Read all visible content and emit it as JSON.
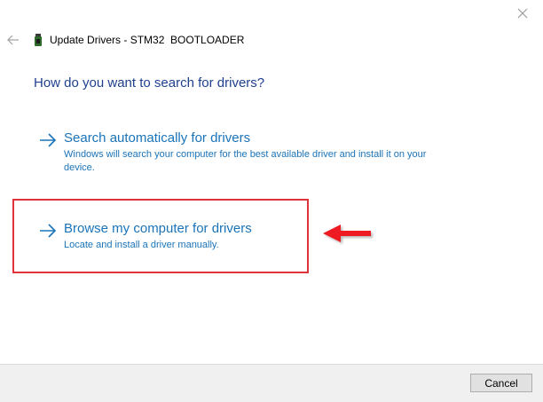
{
  "window": {
    "title": "Update Drivers - STM32  BOOTLOADER",
    "close_icon": "close-icon",
    "back_icon": "back-arrow-icon",
    "device_icon": "usb-device-icon"
  },
  "main": {
    "heading": "How do you want to search for drivers?",
    "options": [
      {
        "title": "Search automatically for drivers",
        "description": "Windows will search your computer for the best available driver and install it on your device.",
        "icon": "arrow-right-icon"
      },
      {
        "title": "Browse my computer for drivers",
        "description": "Locate and install a driver manually.",
        "icon": "arrow-right-icon"
      }
    ]
  },
  "annotation": {
    "highlight_color": "#e0333a",
    "pointer_icon": "red-pointer-arrow-icon"
  },
  "footer": {
    "cancel_label": "Cancel"
  },
  "colors": {
    "heading": "#1f3f8f",
    "link": "#1a73b8",
    "footer_bg": "#f0f0f0"
  }
}
